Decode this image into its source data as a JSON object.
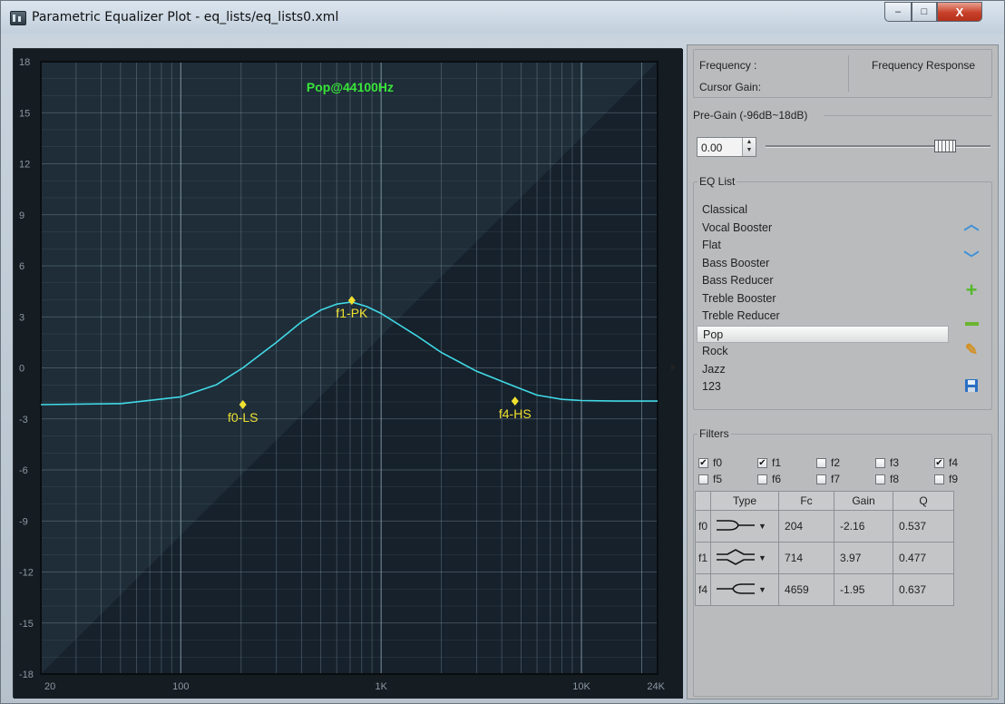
{
  "window": {
    "title": "Parametric Equalizer Plot - eq_lists/eq_lists0.xml",
    "minimize": "–",
    "maximize": "□",
    "close": "X"
  },
  "plot": {
    "overlay_title": "Pop@44100Hz",
    "y_ticks": [
      "18",
      "15",
      "12",
      "9",
      "6",
      "3",
      "0",
      "-3",
      "-6",
      "-9",
      "-12",
      "-15",
      "-18"
    ],
    "x_ticks": [
      "20",
      "100",
      "1K",
      "10K",
      "24K"
    ],
    "markers": [
      "f0-LS",
      "f1-PK",
      "f4-HS"
    ]
  },
  "chart_data": {
    "type": "line",
    "xscale": "log",
    "xlim": [
      20,
      24000
    ],
    "ylim": [
      -18,
      18
    ],
    "grid": true,
    "x": [
      20,
      50,
      100,
      150,
      204,
      300,
      400,
      500,
      600,
      714,
      850,
      1000,
      1500,
      2000,
      3000,
      4659,
      6000,
      8000,
      10000,
      15000,
      24000
    ],
    "series": [
      {
        "color": "#41d9e6",
        "values": [
          -2.16,
          -2.1,
          -1.7,
          -1.0,
          0.0,
          1.5,
          2.7,
          3.4,
          3.75,
          3.87,
          3.6,
          3.2,
          1.9,
          0.9,
          -0.2,
          -1.1,
          -1.6,
          -1.85,
          -1.92,
          -1.95,
          -1.95
        ]
      }
    ],
    "markers": [
      {
        "label": "f0-LS",
        "x": 204,
        "y": -2.16
      },
      {
        "label": "f1-PK",
        "x": 714,
        "y": 3.97
      },
      {
        "label": "f4-HS",
        "x": 4659,
        "y": -1.95
      }
    ]
  },
  "info": {
    "frequency_label": "Frequency :",
    "cursor_gain_label": "Cursor Gain:",
    "response_label": "Frequency Response"
  },
  "pregain": {
    "title": "Pre-Gain (-96dB~18dB)",
    "value": "0.00",
    "slider_level": 0.84
  },
  "eq_list": {
    "title": "EQ List",
    "items": [
      "Classical",
      "Vocal Booster",
      "Flat",
      "Bass Booster",
      "Bass Reducer",
      "Treble Booster",
      "Treble Reducer",
      "Pop",
      "Rock",
      "Jazz",
      "123"
    ],
    "selected": "Pop"
  },
  "filters": {
    "title": "Filters",
    "checks": [
      {
        "label": "f0",
        "checked": true
      },
      {
        "label": "f1",
        "checked": true
      },
      {
        "label": "f2",
        "checked": false
      },
      {
        "label": "f3",
        "checked": false
      },
      {
        "label": "f4",
        "checked": true
      },
      {
        "label": "f5",
        "checked": false
      },
      {
        "label": "f6",
        "checked": false
      },
      {
        "label": "f7",
        "checked": false
      },
      {
        "label": "f8",
        "checked": false
      },
      {
        "label": "f9",
        "checked": false
      }
    ],
    "columns": [
      "Type",
      "Fc",
      "Gain",
      "Q"
    ],
    "rows": [
      {
        "name": "f0",
        "type_icon": "low-shelf-icon",
        "fc": "204",
        "gain": "-2.16",
        "q": "0.537"
      },
      {
        "name": "f1",
        "type_icon": "peak-icon",
        "fc": "714",
        "gain": "3.97",
        "q": "0.477"
      },
      {
        "name": "f4",
        "type_icon": "high-shelf-icon",
        "fc": "4659",
        "gain": "-1.95",
        "q": "0.637"
      }
    ]
  },
  "colors": {
    "plot_bg": "#1e2d38",
    "grid": "#8fa6b6",
    "curve": "#41d9e6",
    "marker": "#f0e030",
    "overlay_title": "#39e639"
  }
}
